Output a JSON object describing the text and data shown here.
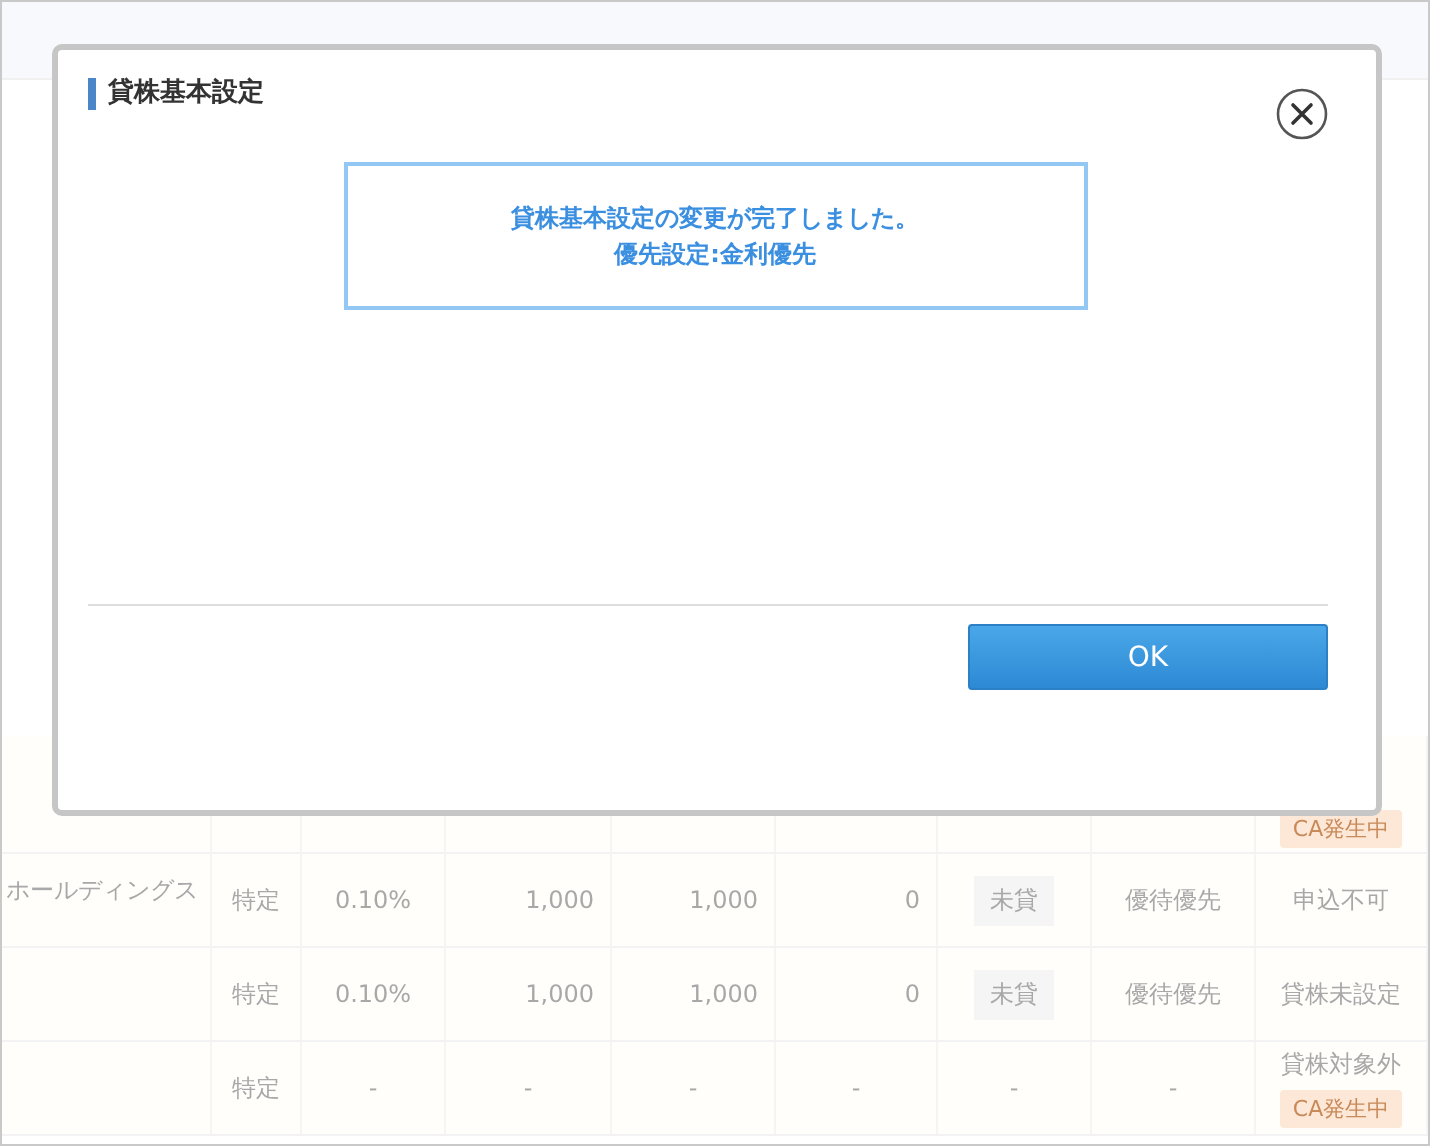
{
  "background_table": {
    "rows": [
      {
        "name": "",
        "cells": [],
        "status": [
          {
            "text": "CA発生中",
            "kind": "badge"
          }
        ]
      },
      {
        "name": "ホールディングス",
        "cells": [
          {
            "text": "特定",
            "kind": "text"
          },
          {
            "text": "0.10%",
            "kind": "text"
          },
          {
            "text": "1,000",
            "kind": "number"
          },
          {
            "text": "1,000",
            "kind": "number"
          },
          {
            "text": "0",
            "kind": "number"
          },
          {
            "text": "未貸",
            "kind": "tag"
          },
          {
            "text": "優待優先",
            "kind": "text"
          }
        ],
        "status": [
          {
            "text": "申込不可",
            "kind": "text"
          }
        ]
      },
      {
        "name": "",
        "cells": [
          {
            "text": "特定",
            "kind": "text"
          },
          {
            "text": "0.10%",
            "kind": "text"
          },
          {
            "text": "1,000",
            "kind": "number"
          },
          {
            "text": "1,000",
            "kind": "number"
          },
          {
            "text": "0",
            "kind": "number"
          },
          {
            "text": "未貸",
            "kind": "tag"
          },
          {
            "text": "優待優先",
            "kind": "text"
          }
        ],
        "status": [
          {
            "text": "貸株未設定",
            "kind": "text"
          }
        ]
      },
      {
        "name": "",
        "cells": [
          {
            "text": "特定",
            "kind": "text"
          },
          {
            "text": "-",
            "kind": "text"
          },
          {
            "text": "-",
            "kind": "text"
          },
          {
            "text": "-",
            "kind": "text"
          },
          {
            "text": "-",
            "kind": "text"
          },
          {
            "text": "-",
            "kind": "text"
          },
          {
            "text": "-",
            "kind": "text"
          }
        ],
        "status": [
          {
            "text": "貸株対象外",
            "kind": "text"
          },
          {
            "text": "CA発生中",
            "kind": "badge"
          }
        ]
      }
    ]
  },
  "dialog": {
    "title": "貸株基本設定",
    "message_lines": [
      "貸株基本設定の変更が完了しました。",
      "優先設定:金利優先"
    ],
    "ok_button": "OK"
  }
}
